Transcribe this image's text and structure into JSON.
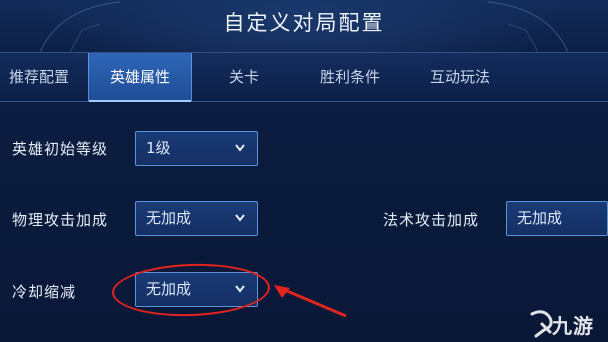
{
  "title": "自定义对局配置",
  "tabs": [
    {
      "label": "推荐配置"
    },
    {
      "label": "英雄属性",
      "active": true
    },
    {
      "label": "关卡"
    },
    {
      "label": "胜利条件"
    },
    {
      "label": "互动玩法"
    }
  ],
  "settings": {
    "initial_level": {
      "label": "英雄初始等级",
      "value": "1级"
    },
    "physical_attack": {
      "label": "物理攻击加成",
      "value": "无加成"
    },
    "magic_attack": {
      "label": "法术攻击加成",
      "value": "无加成"
    },
    "cooldown": {
      "label": "冷却缩减",
      "value": "无加成"
    }
  },
  "watermark": {
    "text": "九游"
  },
  "colors": {
    "background": "#0b1a3d",
    "tab_active": "#2f66b8",
    "select_border": "#5c92d8",
    "annotation": "#e2231e"
  },
  "icons": {
    "dropdown": "chevron-down-icon",
    "annotation_arrow": "arrow-icon",
    "logo": "jiuyou-logo-icon"
  }
}
